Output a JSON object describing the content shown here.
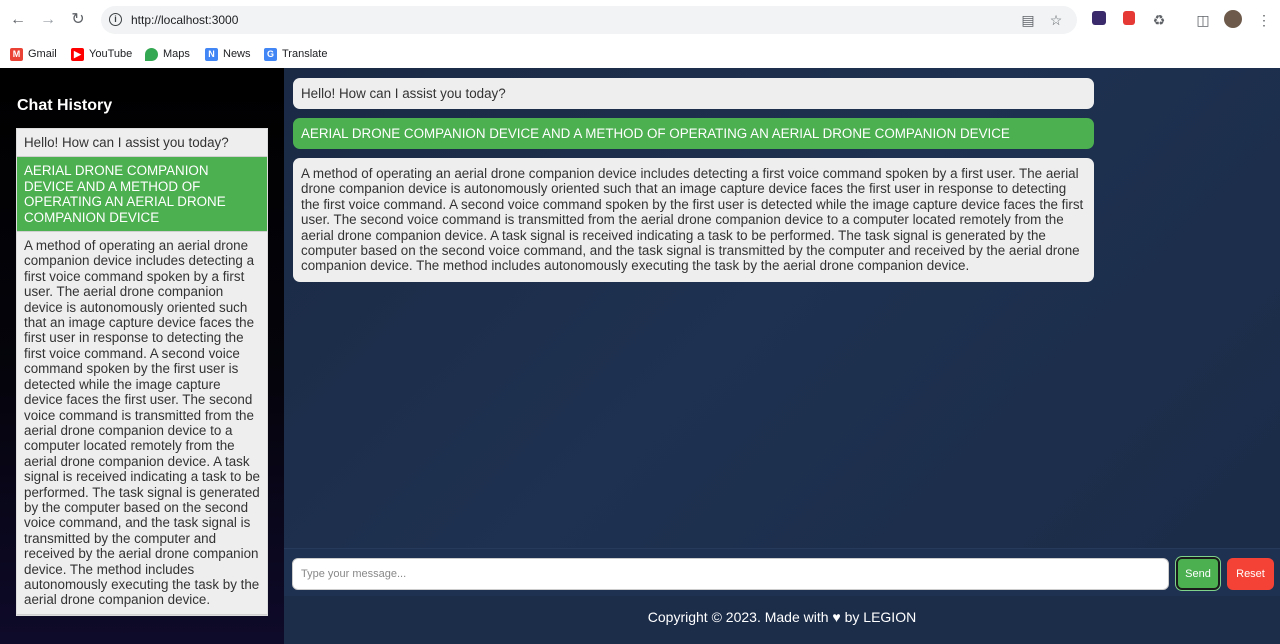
{
  "browser": {
    "url": "http://localhost:3000",
    "bookmarks": [
      {
        "label": "Gmail",
        "icon": "gmail-icon",
        "color": "#ea4335"
      },
      {
        "label": "YouTube",
        "icon": "youtube-icon",
        "color": "#ff0000"
      },
      {
        "label": "Maps",
        "icon": "maps-icon",
        "color": "#34a853"
      },
      {
        "label": "News",
        "icon": "news-icon",
        "color": "#4285f4"
      },
      {
        "label": "Translate",
        "icon": "translate-icon",
        "color": "#4285f4"
      }
    ]
  },
  "sidebar": {
    "title": "Chat History",
    "items": [
      {
        "text": "Hello! How can I assist you today?"
      },
      {
        "text": "AERIAL DRONE COMPANION DEVICE AND A METHOD OF OPERATING AN AERIAL DRONE COMPANION DEVICE"
      },
      {
        "text": "A method of operating an aerial drone companion device includes detecting a first voice command spoken by a first user. The aerial drone companion device is autonomously oriented such that an image capture device faces the first user in response to detecting the first voice command. A second voice command spoken by the first user is detected while the image capture device faces the first user. The second voice command is transmitted from the aerial drone companion device to a computer located remotely from the aerial drone companion device. A task signal is received indicating a task to be performed. The task signal is generated by the computer based on the second voice command, and the task signal is transmitted by the computer and received by the aerial drone companion device. The method includes autonomously executing the task by the aerial drone companion device."
      }
    ]
  },
  "chat": {
    "messages": [
      {
        "text": "Hello! How can I assist you today?"
      },
      {
        "text": "AERIAL DRONE COMPANION DEVICE AND A METHOD OF OPERATING AN AERIAL DRONE COMPANION DEVICE"
      },
      {
        "text": "A method of operating an aerial drone companion device includes detecting a first voice command spoken by a first user. The aerial drone companion device is autonomously oriented such that an image capture device faces the first user in response to detecting the first voice command. A second voice command spoken by the first user is detected while the image capture device faces the first user. The second voice command is transmitted from the aerial drone companion device to a computer located remotely from the aerial drone companion device. A task signal is received indicating a task to be performed. The task signal is generated by the computer based on the second voice command, and the task signal is transmitted by the computer and received by the aerial drone companion device. The method includes autonomously executing the task by the aerial drone companion device."
      }
    ],
    "input_placeholder": "Type your message...",
    "input_value": "",
    "send_label": "Send",
    "reset_label": "Reset"
  },
  "footer": {
    "text": "Copyright © 2023. Made with ♥ by LEGION"
  },
  "colors": {
    "accent_green": "#4caf50",
    "reset_red": "#f44336",
    "main_bg": "#1e3150"
  }
}
